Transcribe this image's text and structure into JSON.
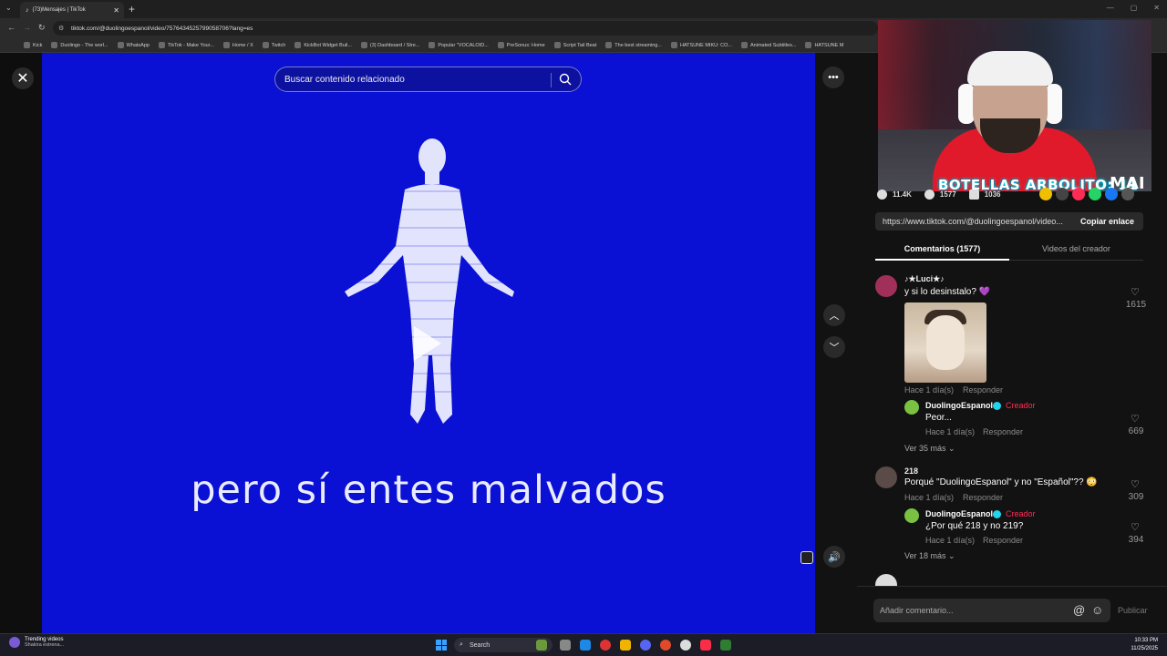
{
  "browser": {
    "tab_title": "(73)Mensajes | TikTok",
    "url": "tiktok.com/@duolingoespanol/video/7576434525799058706?lang=es",
    "bookmarks": [
      "Kick",
      "Duolingo - The worl...",
      "WhatsApp",
      "TikTok - Make Your...",
      "Home / X",
      "Twitch",
      "KickBot Widget Buil...",
      "(3) Dashboard / Stre...",
      "Popular \"VOCALOID...",
      "PreSonus: Home",
      "Script Tail Beat",
      "The best streaming...",
      "HATSUNE MIKU: CO...",
      "Animated Subtitles...",
      "HATSUNE M"
    ]
  },
  "video": {
    "search_placeholder": "Buscar contenido relacionado",
    "caption": "pero sí entes malvados",
    "background_color": "#0a10d4"
  },
  "stream_overlay": {
    "counter_text": "BOTELLAS ARBOLITO: 11",
    "brand": "MAI"
  },
  "stats": {
    "likes": "11.4K",
    "comments": "1577",
    "saves": "1036"
  },
  "share": {
    "link": "https://www.tiktok.com/@duolingoespanol/video...",
    "copy_label": "Copiar enlace"
  },
  "tabs": {
    "comments": "Comentarios (1577)",
    "creator_videos": "Videos del creador"
  },
  "comments": [
    {
      "author": "♪★Luci★♪",
      "text": "y si lo desinstalo? 💜",
      "meta": "Hace 1 día(s)",
      "reply_label": "Responder",
      "likes": "1615",
      "reply": {
        "author": "DuolingoEspanol",
        "badge": "Creador",
        "text": "Peor...",
        "meta": "Hace 1 día(s)",
        "reply_label": "Responder",
        "likes": "669"
      },
      "more": "Ver 35 más"
    },
    {
      "author": "218",
      "text": "Porqué \"DuolingoEspanol\" y no \"Español\"?? 😳",
      "meta": "Hace 1 día(s)",
      "reply_label": "Responder",
      "likes": "309",
      "reply": {
        "author": "DuolingoEspanol",
        "badge": "Creador",
        "text": "¿Por qué 218 y no 219?",
        "meta": "Hace 1 día(s)",
        "reply_label": "Responder",
        "likes": "394"
      },
      "more": "Ver 18 más"
    }
  ],
  "comment_input": {
    "placeholder": "Añadir comentario...",
    "post_label": "Publicar"
  },
  "taskbar": {
    "news_title": "Trending videos",
    "news_sub": "Shakira estrena...",
    "search_label": "Search",
    "time": "10:33 PM",
    "date": "11/25/2025"
  }
}
